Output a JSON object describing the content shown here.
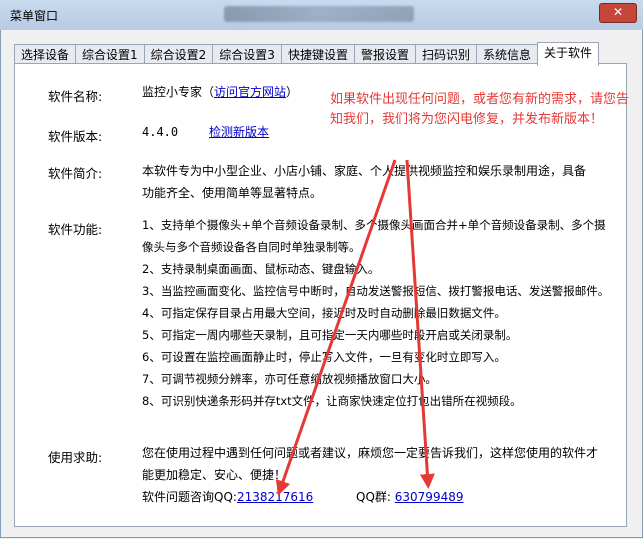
{
  "window": {
    "title": "菜单窗口",
    "close_label": "✕"
  },
  "tabs": [
    "选择设备",
    "综合设置1",
    "综合设置2",
    "综合设置3",
    "快捷键设置",
    "警报设置",
    "扫码识别",
    "系统信息",
    "关于软件"
  ],
  "about": {
    "name_label": "软件名称:",
    "name_value": "监控小专家（",
    "official_link": "访问官方网站",
    "name_close": "）",
    "version_label": "软件版本:",
    "version_value": "4.4.0",
    "check_link": "检测新版本",
    "intro_label": "软件简介:",
    "intro_text": "本软件专为中小型企业、小店小铺、家庭、个人提供视频监控和娱乐录制用途，具备功能齐全、使用简单等显著特点。",
    "features_label": "软件功能:",
    "features": [
      "1、支持单个摄像头+单个音频设备录制、多个摄像头画面合并+单个音频设备录制、多个摄像头与多个音频设备各自同时单独录制等。",
      "2、支持录制桌面画面、鼠标动态、键盘输入。",
      "3、当监控画面变化、监控信号中断时，自动发送警报短信、拨打警报电话、发送警报邮件。",
      "4、可指定保存目录占用最大空间，接近时及时自动删除最旧数据文件。",
      "5、可指定一周内哪些天录制，且可指定一天内哪些时段开启或关闭录制。",
      "6、可设置在监控画面静止时，停止写入文件，一旦有变化时立即写入。",
      "7、可调节视频分辨率，亦可任意缩放视频播放窗口大小。",
      "8、可识别快递条形码并存txt文件，让商家快速定位打包出错所在视频段。"
    ],
    "help_label": "使用求助:",
    "help_text": "您在使用过程中遇到任何问题或者建议，麻烦您一定要告诉我们，这样您使用的软件才能更加稳定、安心、便捷！",
    "qq_label": "软件问题咨询QQ:",
    "qq_value": "2138217616",
    "group_label": "QQ群:",
    "group_value": "630799489",
    "red_note": "如果软件出现任何问题，或者您有新的需求，请您告知我们，我们将为您闪电修复，并发布新版本！"
  },
  "colors": {
    "annotation": "#e53935",
    "link": "#0000cc"
  }
}
